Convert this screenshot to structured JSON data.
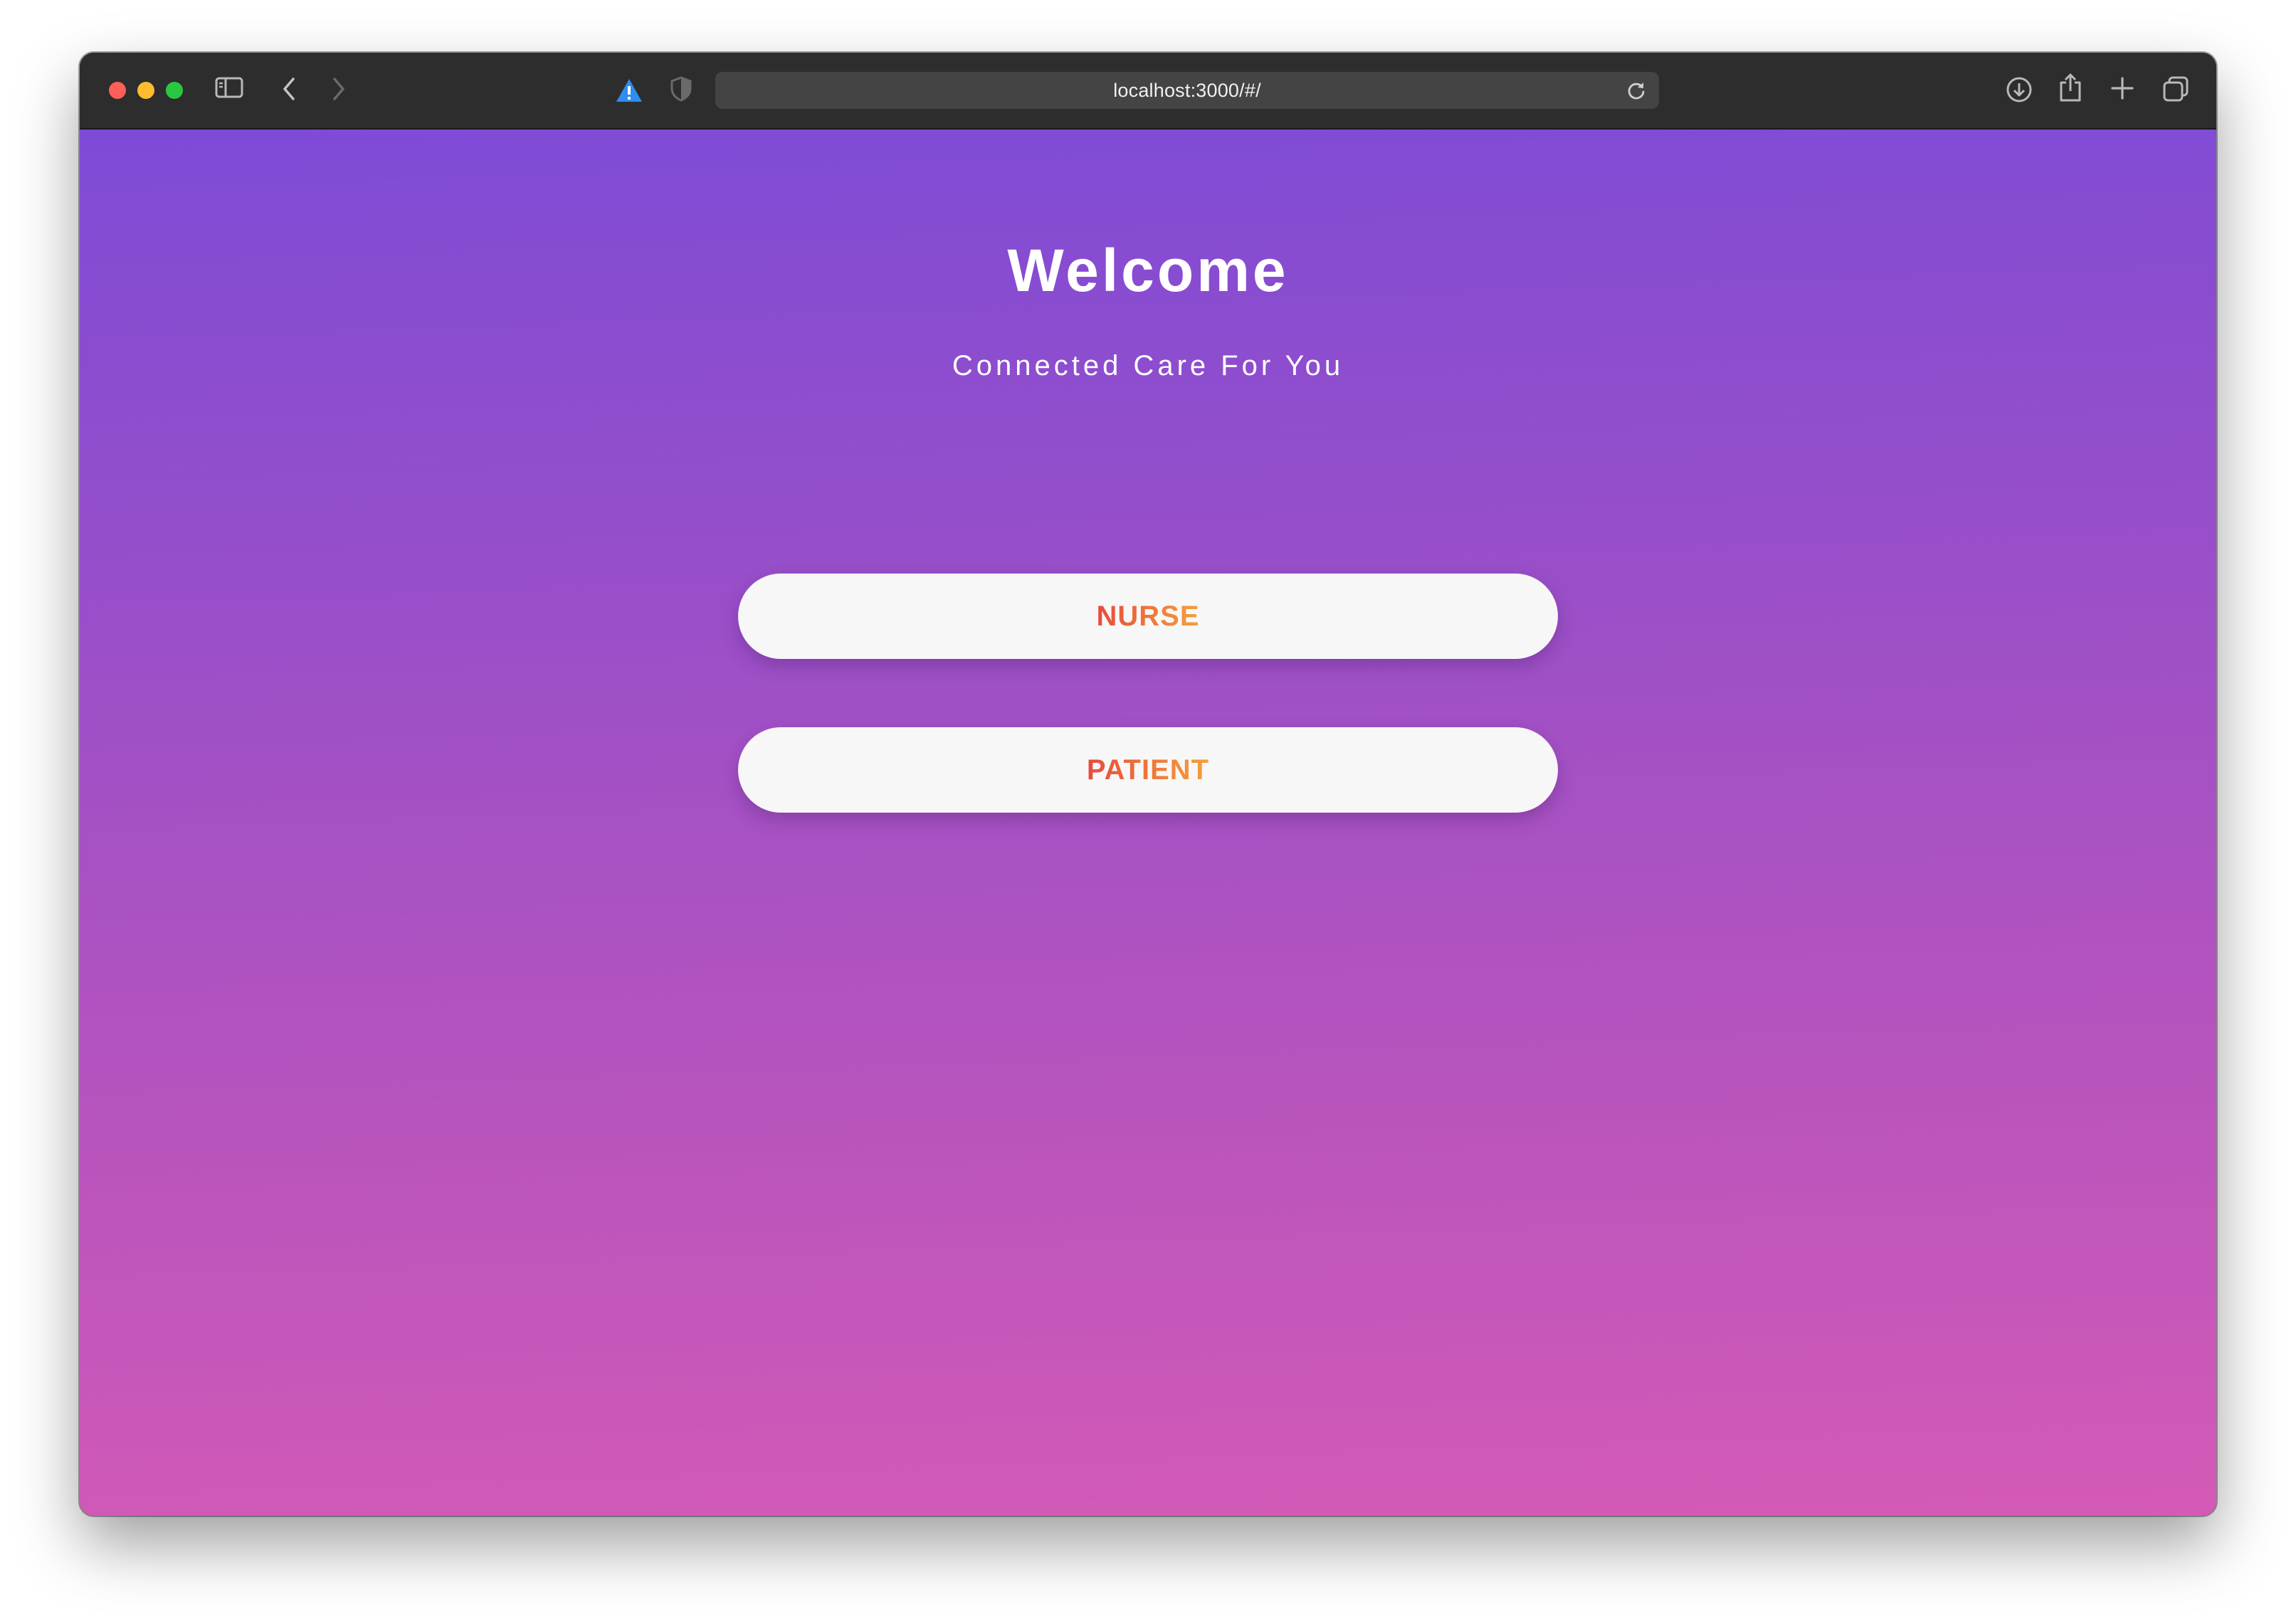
{
  "browser": {
    "url": "localhost:3000/#/"
  },
  "page": {
    "title": "Welcome",
    "subtitle": "Connected Care For You",
    "buttons": [
      {
        "label": "NURSE"
      },
      {
        "label": "PATIENT"
      }
    ]
  },
  "colors": {
    "gradient_top": "#7e4bd6",
    "gradient_bottom": "#d45ab6",
    "button_background": "#f8f7f8",
    "button_text_start": "#e84a3c",
    "button_text_end": "#f5a03a"
  },
  "icons": [
    "sidebar-icon",
    "back-icon",
    "forward-icon",
    "warning-icon",
    "shield-icon",
    "reload-icon",
    "download-icon",
    "share-icon",
    "new-tab-icon",
    "tab-overview-icon"
  ]
}
